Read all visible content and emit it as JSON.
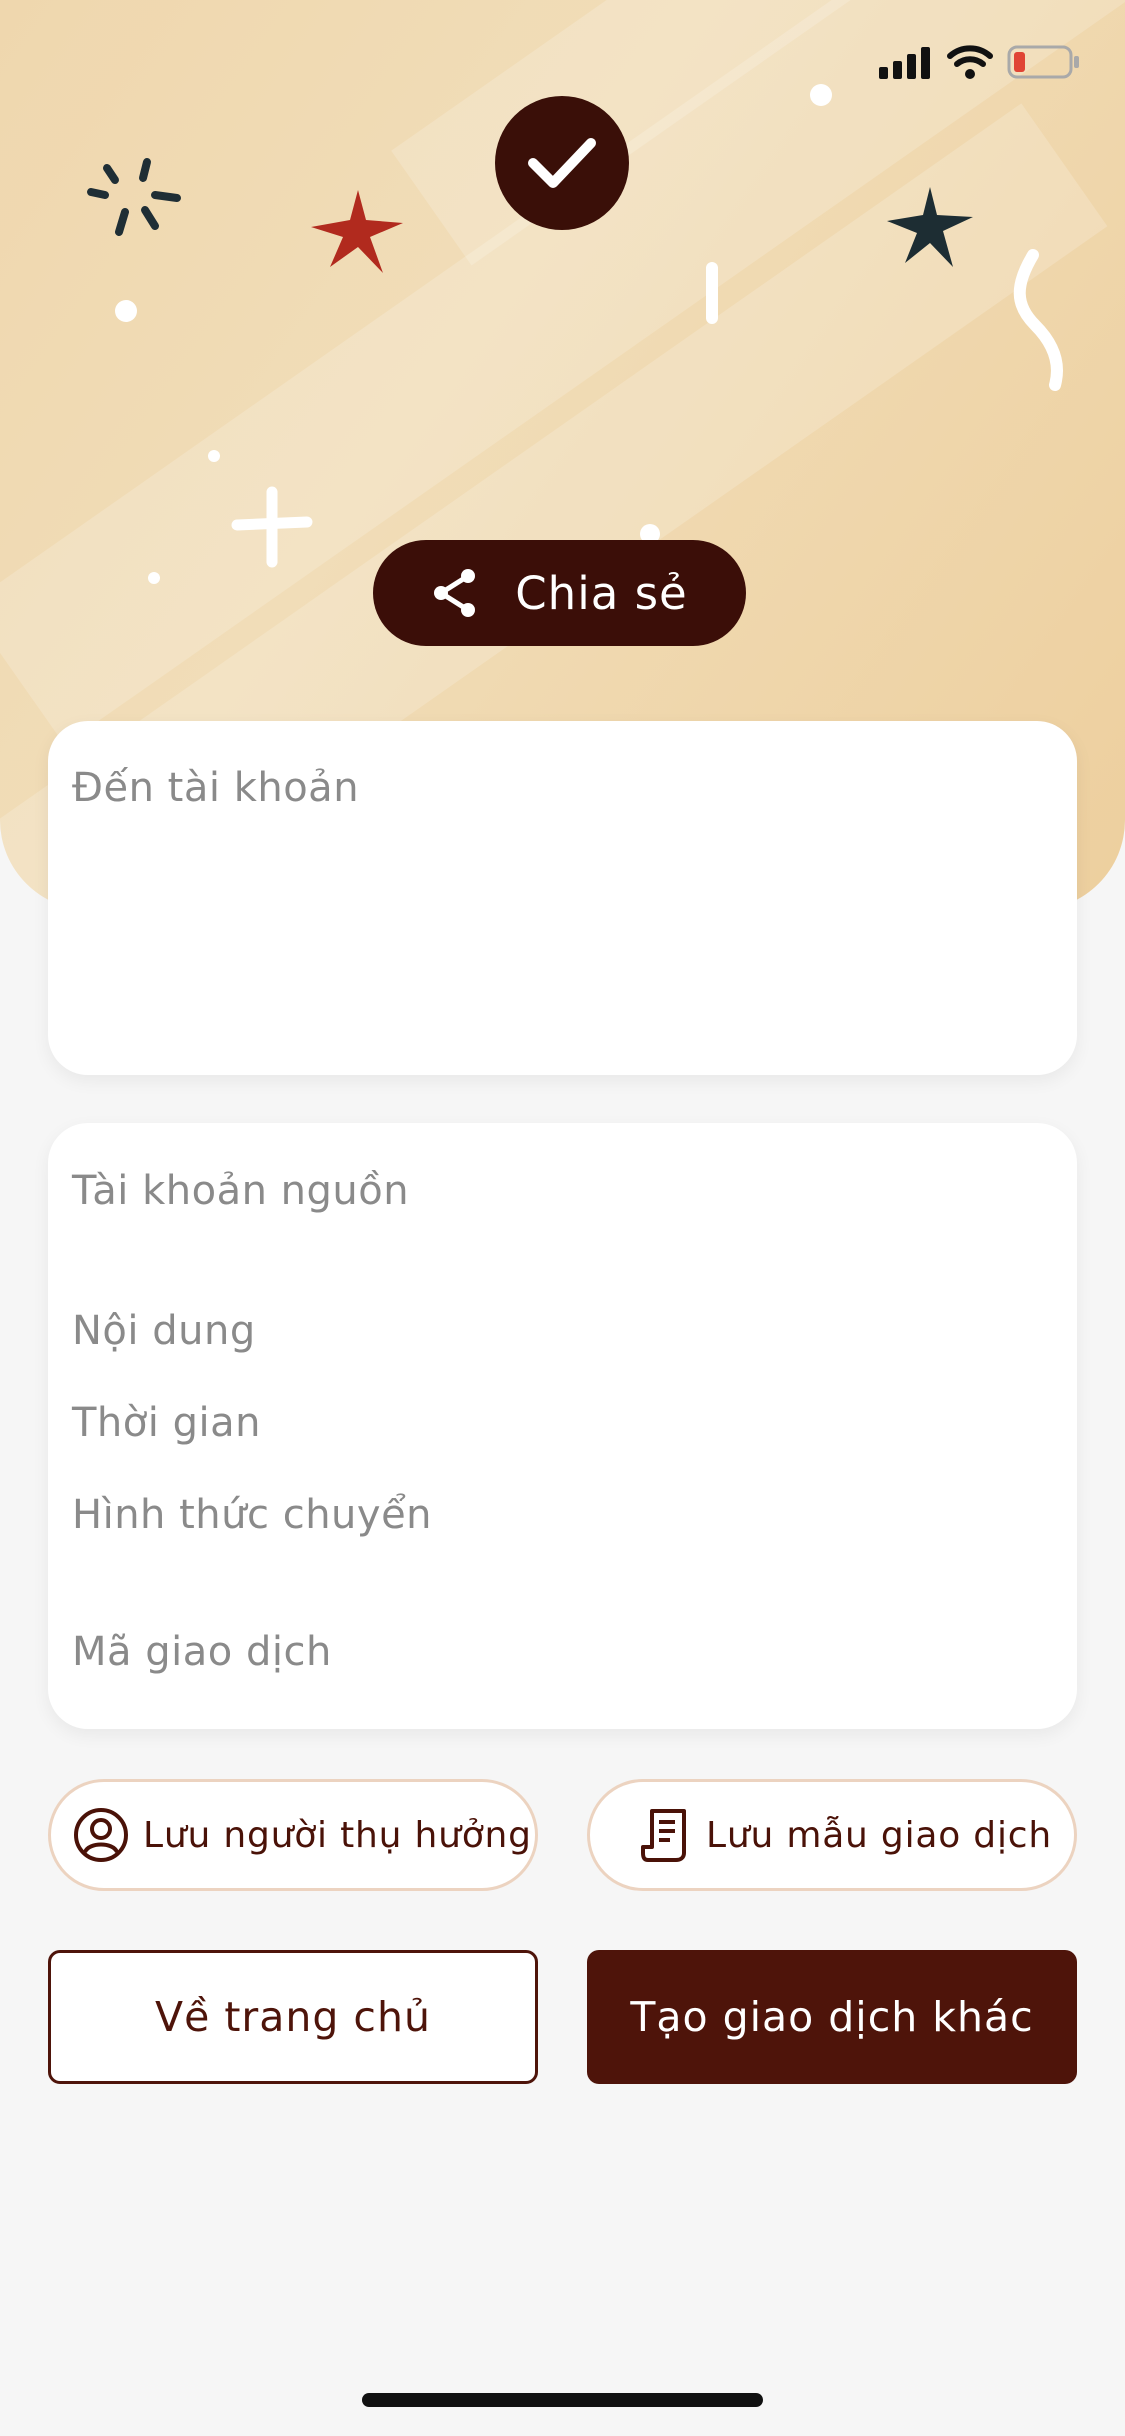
{
  "status": {
    "icons": [
      "signal-icon",
      "wifi-icon",
      "battery-icon"
    ],
    "battery_color": "#e04434"
  },
  "header": {
    "success_icon": "checkmark-icon",
    "share_label": "Chia sẻ",
    "share_icon": "share-icon"
  },
  "destination_card": {
    "title": "Đến tài khoản"
  },
  "info_card": {
    "source_account_label": "Tài khoản nguồn",
    "content_label": "Nội dung",
    "time_label": "Thời gian",
    "transfer_type_label": "Hình thức chuyển",
    "transaction_id_label": "Mã giao dịch"
  },
  "actions": {
    "save_beneficiary": "Lưu người thụ hưởng",
    "save_template": "Lưu mẫu giao dịch",
    "home": "Về trang chủ",
    "new_transaction": "Tạo giao dịch khác"
  },
  "colors": {
    "brand_dark": "#4e140a",
    "banner": "#efd7ae",
    "background": "#f6f6f6"
  }
}
